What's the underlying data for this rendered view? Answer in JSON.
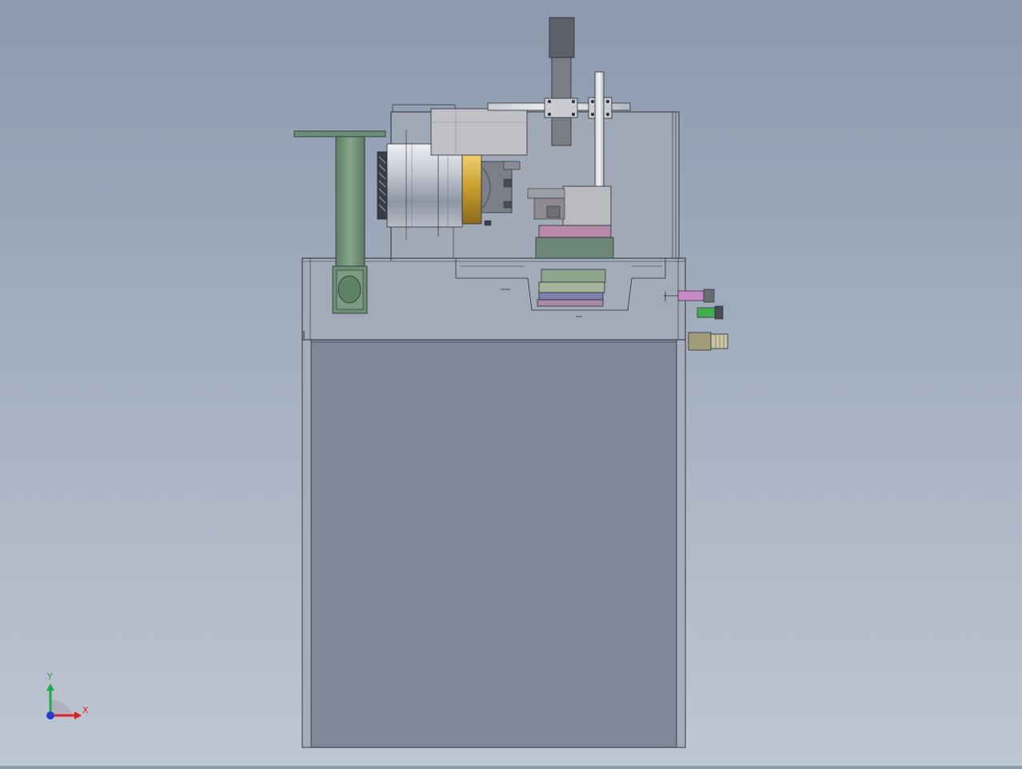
{
  "viewport": {
    "background_top": "#8c9aae",
    "background_bottom": "#bfc6d3",
    "model": "machine-assembly-front-view"
  },
  "triad": {
    "x_label": "X",
    "y_label": "Y",
    "x_color": "#d8232a",
    "y_color": "#1fa84a",
    "z_color": "#2a3ad0"
  },
  "palette": {
    "cabinet": "#808799",
    "guard": "#a0a7b4",
    "motor_green": "#6b8f72",
    "chuck_gold": "#c9a43a",
    "spindle_silver": "#c8ccd4",
    "fitting_pink": "#c888c8",
    "fitting_green": "#3fae4a"
  }
}
